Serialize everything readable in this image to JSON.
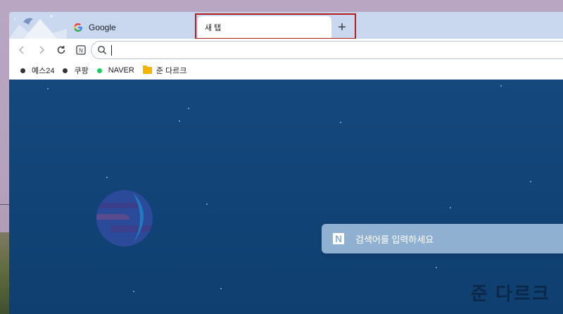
{
  "browser": {
    "tabs": [
      {
        "label": "Google",
        "favicon": "google-g-icon",
        "active": false
      },
      {
        "label": "새 탭",
        "active": true
      }
    ],
    "new_tab_button": "+",
    "toolbar": {
      "back": "back-arrow-icon",
      "forward": "forward-arrow-icon",
      "reload": "reload-icon",
      "naver_icon_label": "N",
      "omnibox_value": ""
    },
    "bookmarks": [
      {
        "label": "예스24",
        "icon": "dot-icon",
        "color": "#333333"
      },
      {
        "label": "쿠팡",
        "icon": "dot-icon",
        "color": "#333333"
      },
      {
        "label": "NAVER",
        "icon": "dot-icon",
        "color": "#19ce60"
      },
      {
        "label": "준 다르크",
        "icon": "folder-icon",
        "color": "#f4b400"
      }
    ]
  },
  "new_tab_page": {
    "search_logo": "N",
    "search_placeholder": "검색어를 입력하세요",
    "watermark": "준 다르크"
  },
  "colors": {
    "tabstrip": "#c9d8ef",
    "content_bg": "#124478",
    "search_card": "#8fb0d1",
    "highlight": "#b71c1c"
  }
}
